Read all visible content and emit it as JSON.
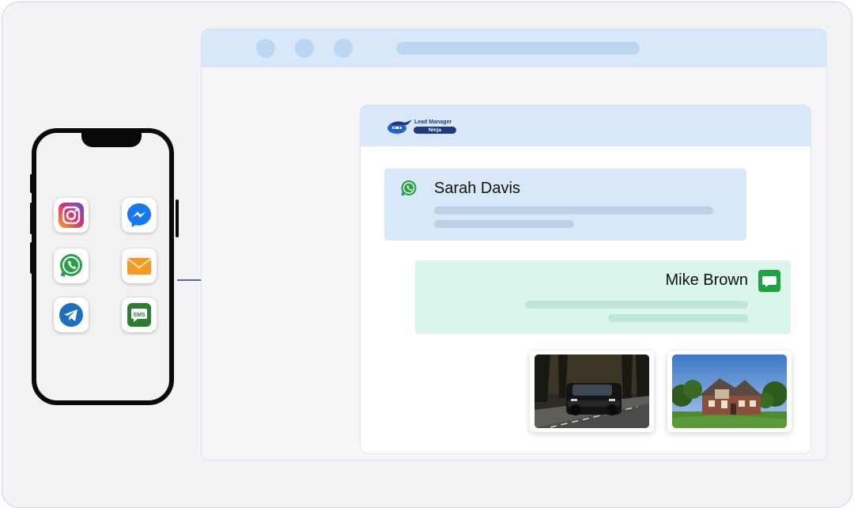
{
  "app": {
    "logo_line1": "Lead Manager",
    "logo_line2": "Ninja"
  },
  "conversation": {
    "incoming": {
      "sender": "Sarah Davis",
      "channel_icon": "whatsapp-icon"
    },
    "outgoing": {
      "sender": "Mike Brown",
      "channel_icon": "message-icon"
    },
    "attachments": [
      {
        "subject": "SUV driving on a forest road"
      },
      {
        "subject": "Brick house with lawn"
      }
    ]
  },
  "phone": {
    "apps": [
      "instagram-icon",
      "messenger-icon",
      "whatsapp-icon",
      "email-icon",
      "telegram-icon",
      "sms-icon"
    ],
    "sms_label": "SMS"
  },
  "colors": {
    "accent_blue": "#d8e8f8",
    "accent_green": "#d9f5ec",
    "brand_navy": "#1f3a7a",
    "arrow": "#1f3a7a"
  }
}
